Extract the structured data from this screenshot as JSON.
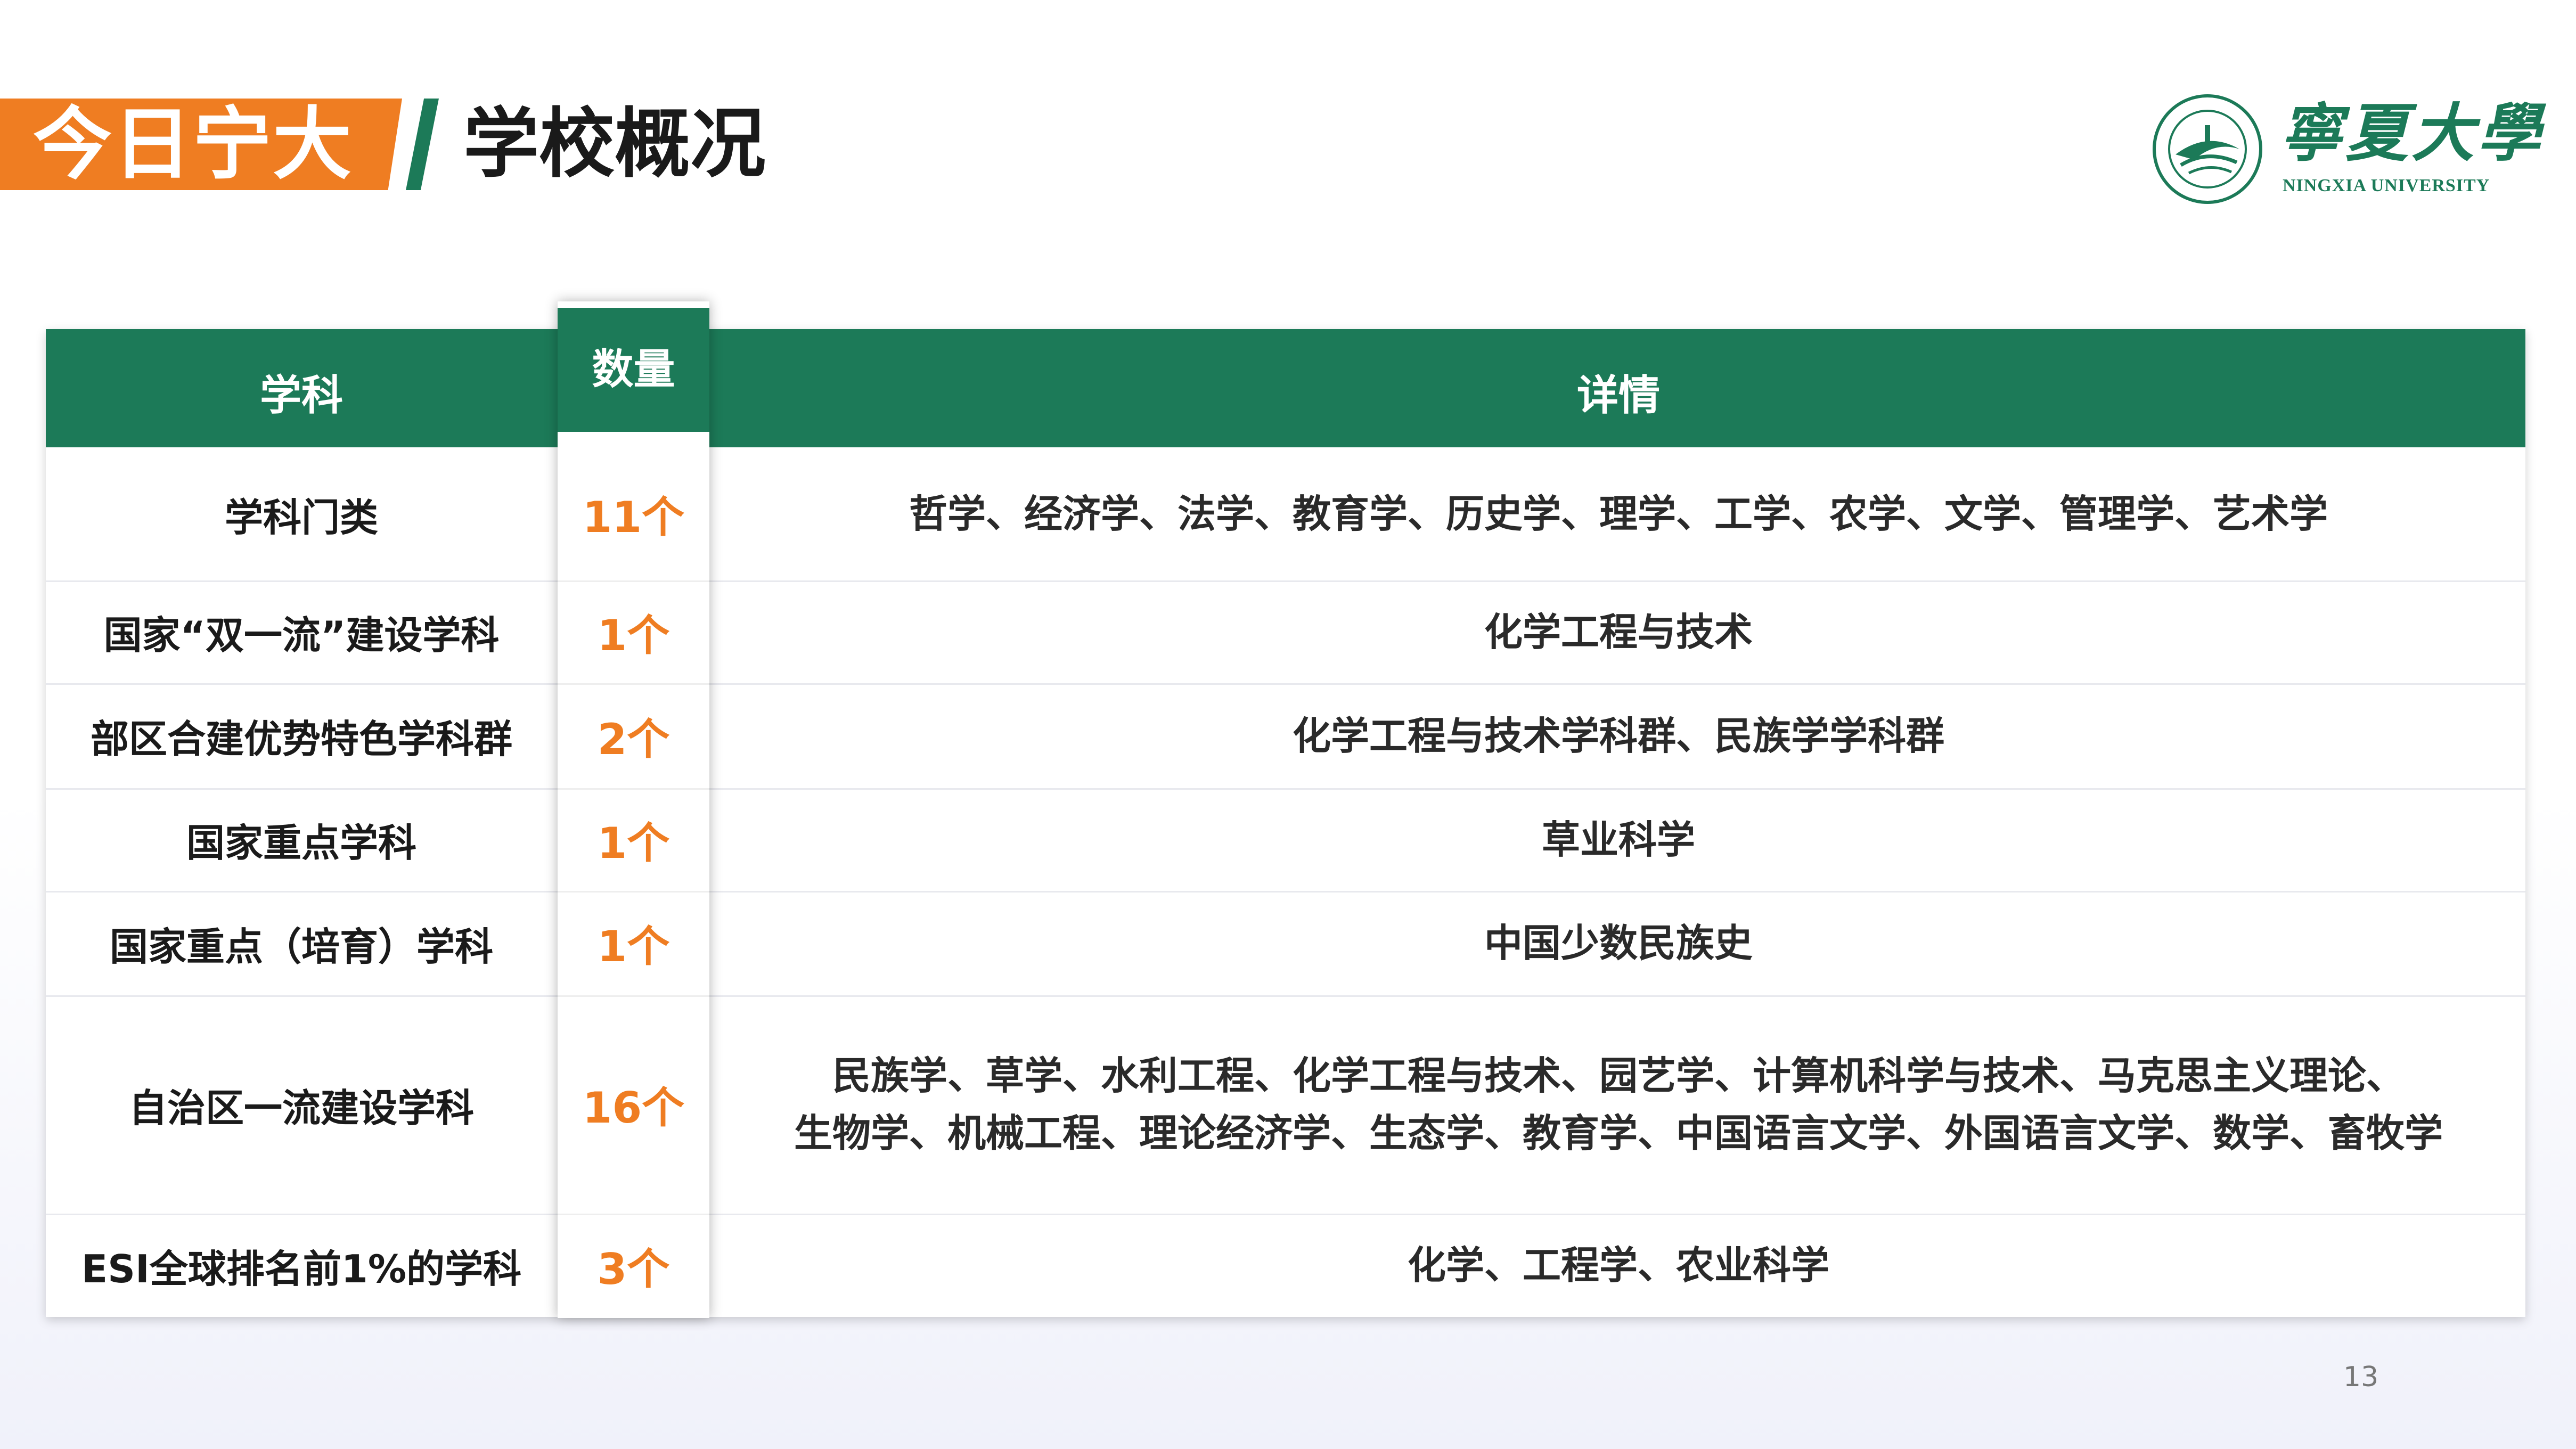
{
  "header": {
    "tag": "今日宁大",
    "title": "学校概况"
  },
  "logo": {
    "name_cn": "寧夏大學",
    "name_en": "NINGXIA UNIVERSITY"
  },
  "table": {
    "columns": [
      "学科",
      "数量",
      "详情"
    ],
    "rows": [
      {
        "subject": "学科门类",
        "count": "11个",
        "details": [
          "哲学、经济学、法学、教育学、历史学、理学、工学、农学、文学、管理学、艺术学"
        ]
      },
      {
        "subject": "国家“双一流”建设学科",
        "count": "1个",
        "details": [
          "化学工程与技术"
        ]
      },
      {
        "subject": "部区合建优势特色学科群",
        "count": "2个",
        "details": [
          "化学工程与技术学科群、民族学学科群"
        ]
      },
      {
        "subject": "国家重点学科",
        "count": "1个",
        "details": [
          "草业科学"
        ]
      },
      {
        "subject": "国家重点（培育）学科",
        "count": "1个",
        "details": [
          "中国少数民族史"
        ]
      },
      {
        "subject": "自治区一流建设学科",
        "count": "16个",
        "details": [
          "民族学、草学、水利工程、化学工程与技术、园艺学、计算机科学与技术、马克思主义理论、",
          "生物学、机械工程、理论经济学、生态学、教育学、中国语言文学、外国语言文学、数学、畜牧学"
        ]
      },
      {
        "subject": "ESI全球排名前1%的学科",
        "count": "3个",
        "details": [
          "化学、工程学、农业科学"
        ]
      }
    ]
  },
  "page_number": "13",
  "colors": {
    "accent_orange": "#ef7d22",
    "brand_green": "#1c7a58"
  }
}
